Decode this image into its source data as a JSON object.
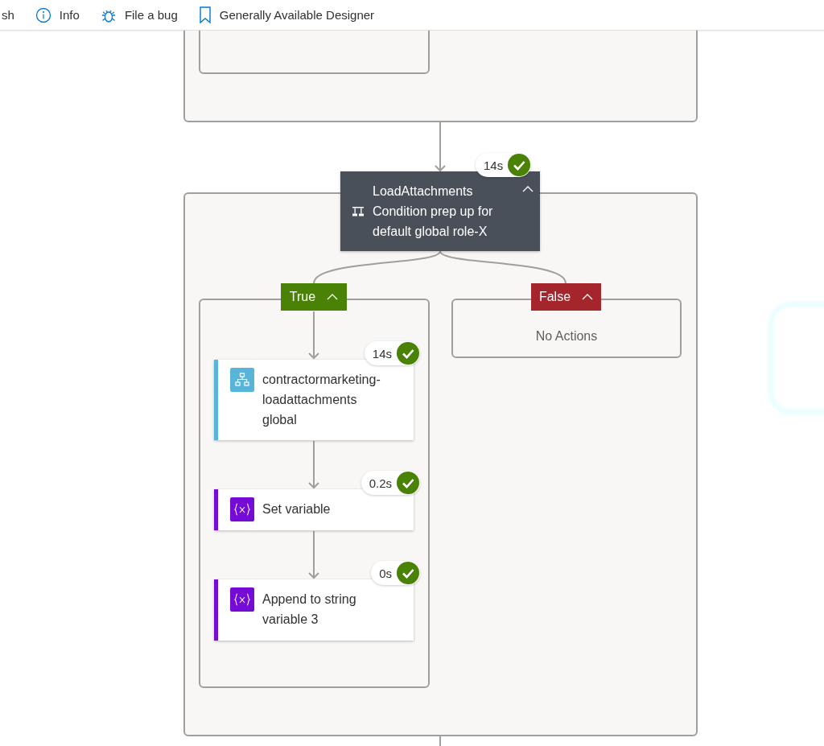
{
  "toolbar": [
    {
      "label": "sh",
      "kind": "text"
    },
    {
      "label": "Info",
      "kind": "info"
    },
    {
      "label": "File a bug",
      "kind": "bug"
    },
    {
      "label": "Generally Available Designer",
      "kind": "bookmark"
    }
  ],
  "condition": {
    "title": "LoadAttachments",
    "subtitle": "Condition prep up for default global role-X",
    "duration": "14s",
    "succeeded": true,
    "expanded": true
  },
  "branches": [
    {
      "label": "True",
      "kind": "true",
      "expanded": true,
      "actions": [
        {
          "name": "contractormarketing-loadattachments global",
          "kind": "workflow",
          "duration": "14s",
          "succeeded": true
        },
        {
          "name": "Set variable",
          "kind": "variable",
          "duration": "0.2s",
          "succeeded": true
        },
        {
          "name": "Append to string variable 3",
          "kind": "variable",
          "duration": "0s",
          "succeeded": true
        }
      ]
    },
    {
      "label": "False",
      "kind": "false",
      "expanded": true,
      "empty_text": "No Actions"
    }
  ]
}
